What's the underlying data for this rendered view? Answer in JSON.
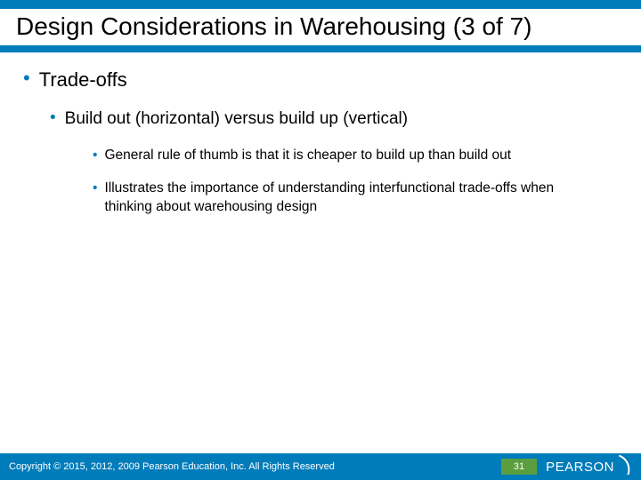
{
  "title": "Design Considerations in Warehousing (3 of 7)",
  "bullets": {
    "l1": "Trade-offs",
    "l2": "Build out (horizontal) versus build up (vertical)",
    "l3a": "General rule of thumb is that it is cheaper to build up than build out",
    "l3b": "Illustrates the importance of understanding interfunctional trade-offs when thinking about warehousing design"
  },
  "footer": {
    "copyright": "Copyright © 2015, 2012, 2009 Pearson Education, Inc. All Rights Reserved",
    "page": "31",
    "brand": "PEARSON"
  }
}
